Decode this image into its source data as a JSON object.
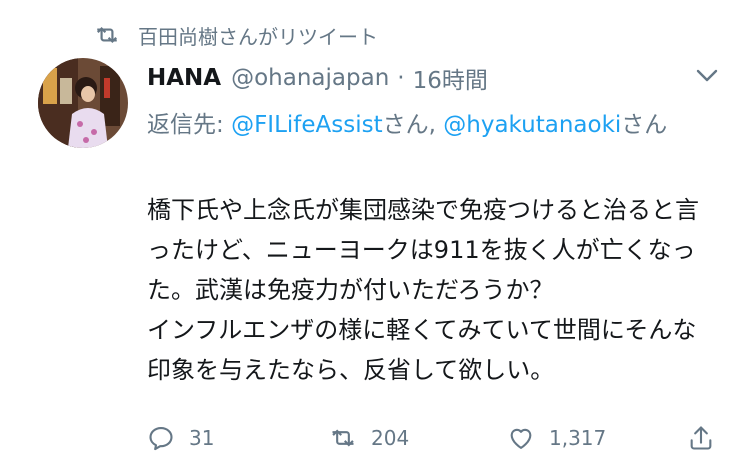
{
  "retweet": {
    "icon": "retweet-icon",
    "text": "百田尚樹さんがリツイート"
  },
  "tweet": {
    "name": "HANA",
    "handle": "@ohanajapan",
    "separator": "·",
    "time": "16時間",
    "reply_prefix": "返信先: ",
    "reply_mention_1": "@FILifeAssist",
    "reply_mid": "さん, ",
    "reply_mention_2": "@hyakutanaoki",
    "reply_suffix": "さん",
    "text_line_1": "橋下氏や上念氏が集団感染で免疫つけると治ると言ったけど、ニューヨークは911を抜く人が亡くなった。武漢は免疫力が付いただろうか？",
    "text_line_2": "インフルエンザの様に軽くてみていて世間にそんな印象を与えたなら、反省して欲しい。"
  },
  "actions": {
    "reply_count": "31",
    "retweet_count": "204",
    "like_count": "1,317"
  },
  "colors": {
    "accent": "#1da1f2",
    "muted": "#657786",
    "text": "#14171a"
  }
}
